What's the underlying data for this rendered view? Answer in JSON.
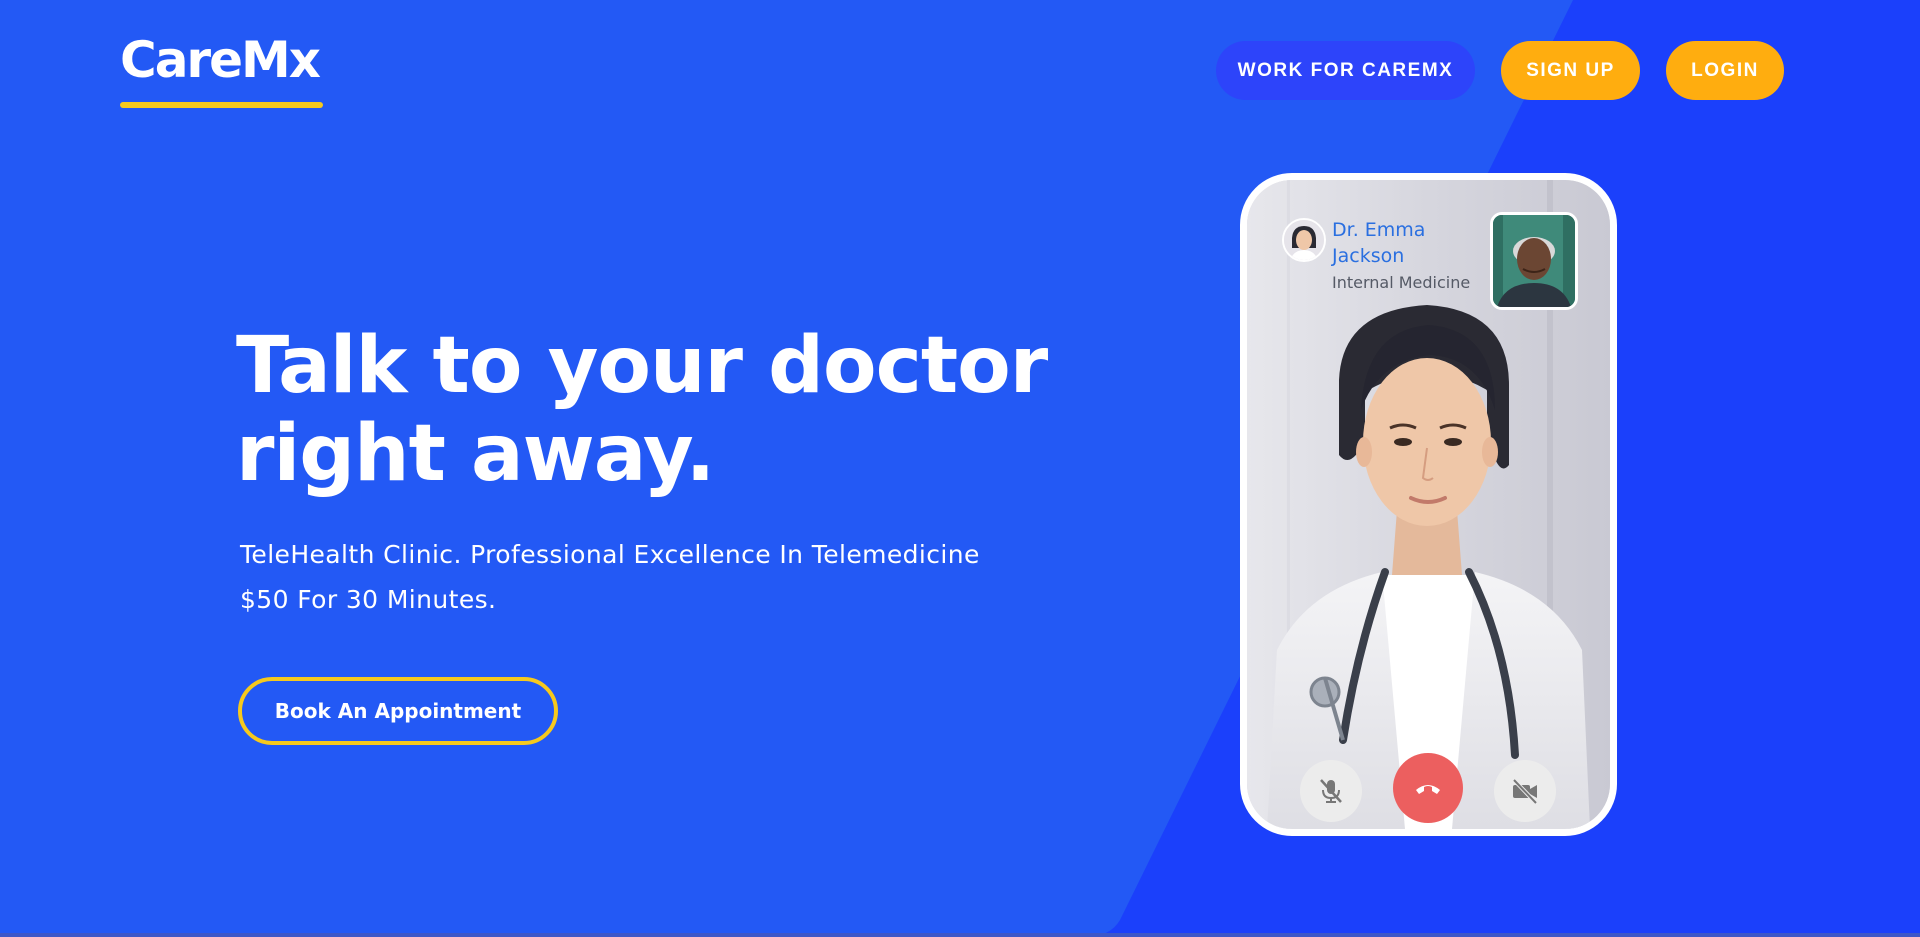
{
  "brand": {
    "name": "CareMx",
    "accent_color": "#f6c91d",
    "background_color": "#1b40fb",
    "panel_color": "#2359f5"
  },
  "nav": {
    "work_label": "WORK FOR CAREMX",
    "signup_label": "SIGN UP",
    "login_label": "LOGIN",
    "button_color": "#ffad0f"
  },
  "hero": {
    "title_line1": "Talk to your doctor",
    "title_line2": "right away.",
    "subtitle_line1": "TeleHealth Clinic. Professional Excellence In Telemedicine",
    "subtitle_line2": "$50 For 30 Minutes.",
    "cta_label": "Book An Appointment"
  },
  "video_call": {
    "doctor_name": "Dr. Emma Jackson",
    "doctor_specialty": "Internal Medicine",
    "controls": {
      "mute_icon": "mic-off-icon",
      "end_icon": "end-call-icon",
      "video_icon": "video-off-icon",
      "end_color": "#ec5f5f"
    }
  }
}
